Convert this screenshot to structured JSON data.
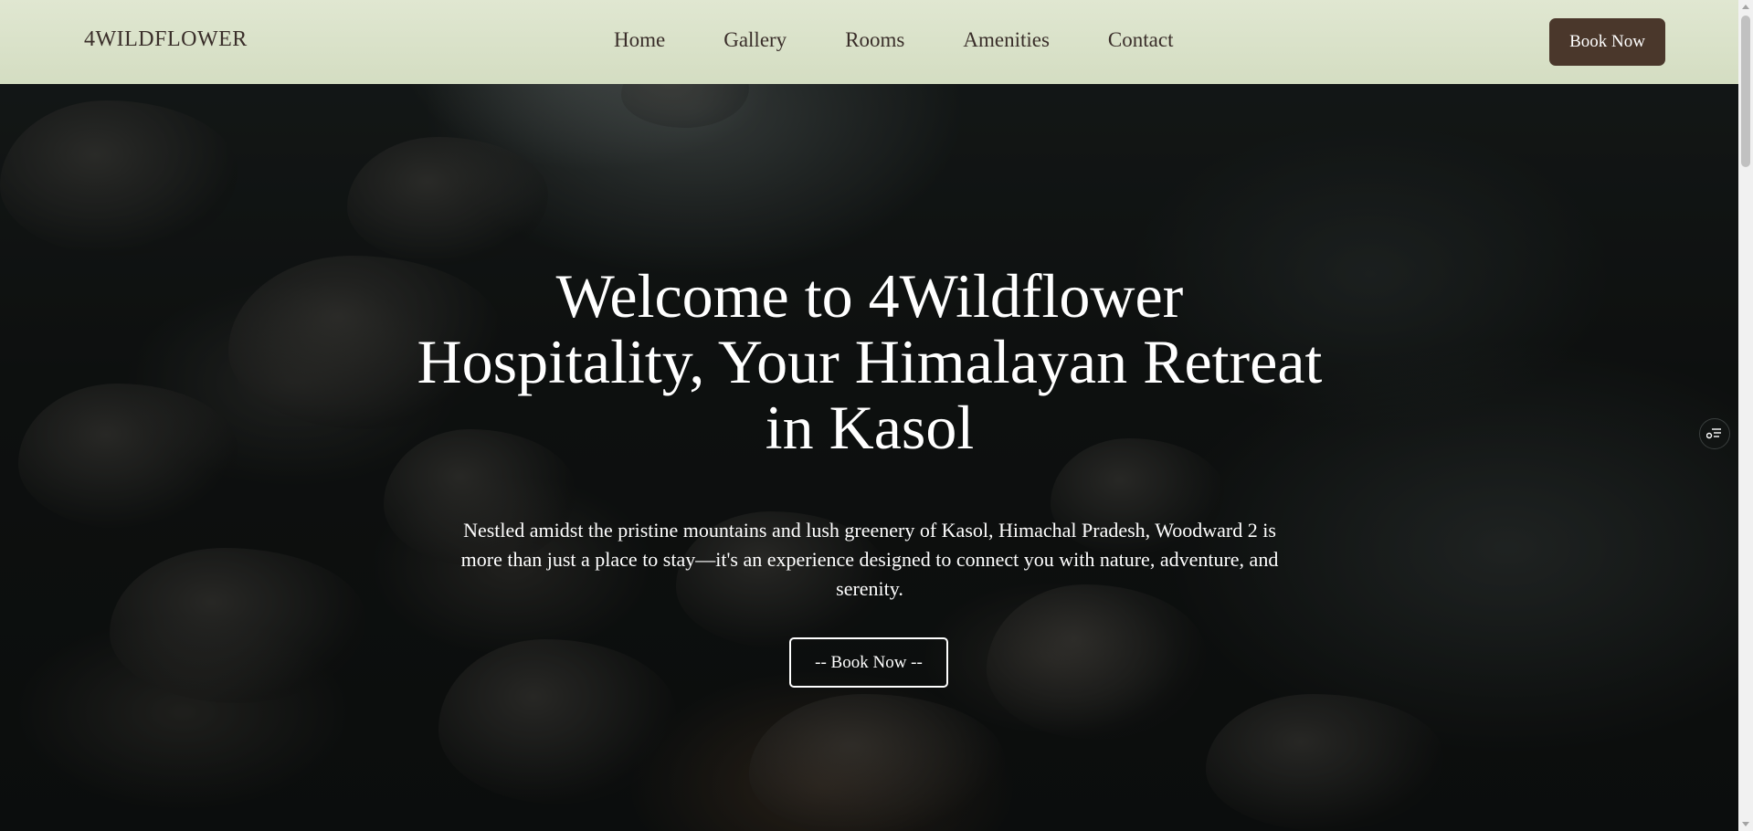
{
  "nav": {
    "brand": "4WILDFLOWER",
    "links": [
      "Home",
      "Gallery",
      "Rooms",
      "Amenities",
      "Contact"
    ],
    "cta_label": "Book Now"
  },
  "hero": {
    "title": "Welcome to 4Wildflower Hospitality, Your Himalayan Retreat in Kasol",
    "description": "Nestled amidst the pristine mountains and lush greenery of Kasol, Himachal Pradesh, Woodward 2 is more than just a place to stay—it's an experience designed to connect you with nature, adventure, and serenity.",
    "cta_label": "-- Book Now --",
    "background_icon": "rocks-water-photo"
  },
  "widgets": {
    "floating_icon": "settings-list-icon"
  },
  "colors": {
    "nav_background": "#dde5cd",
    "nav_text": "#3a2e2a",
    "cta_background": "#4a372b",
    "hero_text": "#ffffff"
  }
}
